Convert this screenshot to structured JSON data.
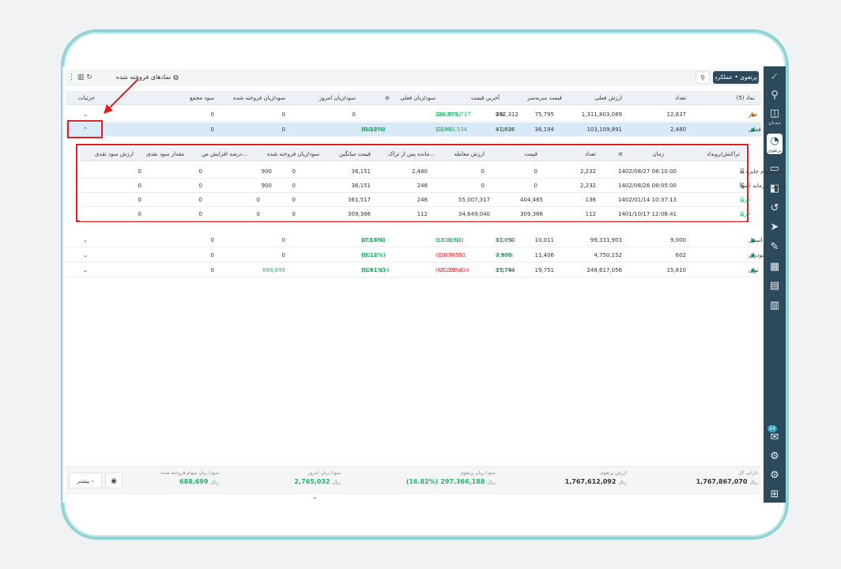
{
  "rail": {
    "items": [
      {
        "icon": "logo-icon",
        "glyph": "✓"
      },
      {
        "icon": "search-icon",
        "glyph": "⚲"
      },
      {
        "icon": "watch-icon",
        "glyph": "◫",
        "label": "دیدبان"
      },
      {
        "icon": "portfolio-icon",
        "glyph": "◔",
        "label": "پرتفوی",
        "active": true
      },
      {
        "icon": "ipo-icon",
        "glyph": "▭"
      },
      {
        "icon": "wallet-icon",
        "glyph": "◧"
      },
      {
        "icon": "history-icon",
        "glyph": "↺"
      },
      {
        "icon": "send-icon",
        "glyph": "➤"
      },
      {
        "icon": "edit-icon",
        "glyph": "✎"
      },
      {
        "icon": "grid-icon",
        "glyph": "▦"
      },
      {
        "icon": "report-icon",
        "glyph": "▤"
      },
      {
        "icon": "chart-icon",
        "glyph": "▥"
      }
    ],
    "bottom": [
      {
        "icon": "chat-icon",
        "glyph": "✉",
        "badge": "24"
      },
      {
        "icon": "settings-user-icon",
        "glyph": "⚙"
      },
      {
        "icon": "gear-icon",
        "glyph": "⚙"
      },
      {
        "icon": "apps-icon",
        "glyph": "⊞"
      }
    ]
  },
  "topbar": {
    "perf_label": "پرتفوی • عملکرد",
    "sold_symbols_label": "نمادهای فروخته شده"
  },
  "main_table": {
    "headers": {
      "symbol": "نماد (5)",
      "count": "تعداد",
      "current_value": "ارزش فعلی",
      "breakeven": "قیمت سربه‌سر",
      "last_price": "آخرین قیمت",
      "current_pl": "سود/زیان فعلی",
      "today_pl": "سود/زیان امروز",
      "sold_pl": "سود/زیان فروخته شده",
      "total_profit": "سود مجمع",
      "details": "جزئیات"
    },
    "rows": [
      {
        "symbol": "عیار",
        "dot": "#f5a623",
        "count": "12,837",
        "current_value": "1,311,803,089",
        "breakeven": "75,795",
        "last_price": "102,312",
        "last_pct": "0%",
        "current_pl": "339,979,737",
        "current_pl_pct": "(34.95%)",
        "today_pl": "0",
        "sold_pl": "0",
        "total_profit": "0",
        "chevron": "⌄"
      },
      {
        "symbol": "فملی",
        "dot": "#23b26a",
        "count": "2,480",
        "current_value": "103,109,891",
        "breakeven": "36,194",
        "last_price": "41,626",
        "last_pct": "0.33%",
        "current_pl": "13,453,534",
        "current_pl_pct": "(15%)",
        "today_pl": "336,879",
        "today_pl_pct": "(0.32%)",
        "sold_pl": "0",
        "total_profit": "0",
        "chevron": "⌃"
      },
      {
        "symbol": "استیل",
        "dot": "#23b26a",
        "count": "9,000",
        "current_value": "99,331,903",
        "breakeven": "10,011",
        "last_price": "11,050",
        "last_pct": "0.18%",
        "current_pl": "9,331,903",
        "current_pl_pct": "(10.36%)",
        "today_pl": "179,786",
        "today_pl_pct": "(0.18%)",
        "sold_pl": "0",
        "total_profit": "0",
        "chevron": "⌄"
      },
      {
        "symbol": "خودران",
        "dot": "#23b26a",
        "count": "602",
        "current_value": "4,750,152",
        "breakeven": "11,406",
        "last_price": "7,900",
        "last_pct": "0.13%",
        "current_pl": "-2,108,553",
        "current_pl_pct": "(-30.74%)",
        "today_pl": "6,013",
        "today_pl_pct": "(0.12%)",
        "sold_pl": "0",
        "total_profit": "0",
        "chevron": "⌄"
      },
      {
        "symbol": "توان",
        "dot": "#23b26a",
        "count": "15,810",
        "current_value": "248,617,056",
        "breakeven": "19,751",
        "last_price": "15,744",
        "last_pct": "0.91%",
        "current_pl": "-63,290,434",
        "current_pl_pct": "(-20.29%)",
        "today_pl": "2,242,354",
        "today_pl_pct": "(0.91%)",
        "sold_pl": "688,699",
        "total_profit": "0",
        "chevron": "⌄"
      }
    ]
  },
  "sub_table": {
    "headers": {
      "event": "تراکنش/رویداد",
      "time": "زمان",
      "count": "تعداد",
      "price": "قیمت",
      "trade_value": "ارزش معامله",
      "remaining": "مانده پس از تراک...",
      "avg_price": "قیمت میانگین",
      "sold_pl": "سود/زیان فروخته شده",
      "increase_pct": "درصد افزایش س...",
      "cash_div": "مقدار سود نقدی",
      "cash_div_value": "ارزش سود نقدی"
    },
    "rows": [
      {
        "event": "تبدیل سهام جایزه به",
        "buy": false,
        "time": "1402/08/27 08:10:00",
        "count": "2,232",
        "price": "0",
        "trade_value": "0",
        "remaining": "2,480",
        "avg_price": "36,151",
        "sold_pl": "0",
        "increase_pct": "900",
        "cash_div": "0",
        "cash_div_value": "0"
      },
      {
        "event": "افزایش سرمایه (سها",
        "buy": false,
        "time": "1402/08/26 08:05:00",
        "count": "2,232",
        "price": "0",
        "trade_value": "0",
        "remaining": "248",
        "avg_price": "36,151",
        "sold_pl": "0",
        "increase_pct": "900",
        "cash_div": "0",
        "cash_div_value": "0"
      },
      {
        "event": "خرید",
        "buy": true,
        "time": "1402/01/14 10:37:13",
        "count": "136",
        "price": "404,465",
        "trade_value": "55,007,317",
        "remaining": "248",
        "avg_price": "361,517",
        "sold_pl": "0",
        "increase_pct": "0",
        "cash_div": "0",
        "cash_div_value": "0"
      },
      {
        "event": "خرید",
        "buy": true,
        "time": "1401/10/17 12:08:41",
        "count": "112",
        "price": "309,366",
        "trade_value": "34,649,040",
        "remaining": "112",
        "avg_price": "309,366",
        "sold_pl": "0",
        "increase_pct": "0",
        "cash_div": "0",
        "cash_div_value": "0"
      }
    ]
  },
  "footer": {
    "total_assets_label": "دارایی کل",
    "total_assets_value": "1,767,867,070",
    "portfolio_value_label": "ارزش پرتفوی",
    "portfolio_value_value": "1,767,612,092",
    "portfolio_pl_label": "سود/ زیان پرتفوی",
    "portfolio_pl_value": "297,366,188",
    "portfolio_pl_pct": "(%16.82)",
    "today_pl_label": "سود/ زیان امروز",
    "today_pl_value": "2,765,032",
    "sold_pl_label": "سود/ زیان سهام فروخته شده",
    "sold_pl_value": "688,699",
    "unit": "ریال",
    "more_label": "بیشتر",
    "colors": {
      "accent": "#2c4a5b",
      "positive": "#23b26a",
      "negative": "#e0464a",
      "highlight": "#e31b23"
    }
  }
}
